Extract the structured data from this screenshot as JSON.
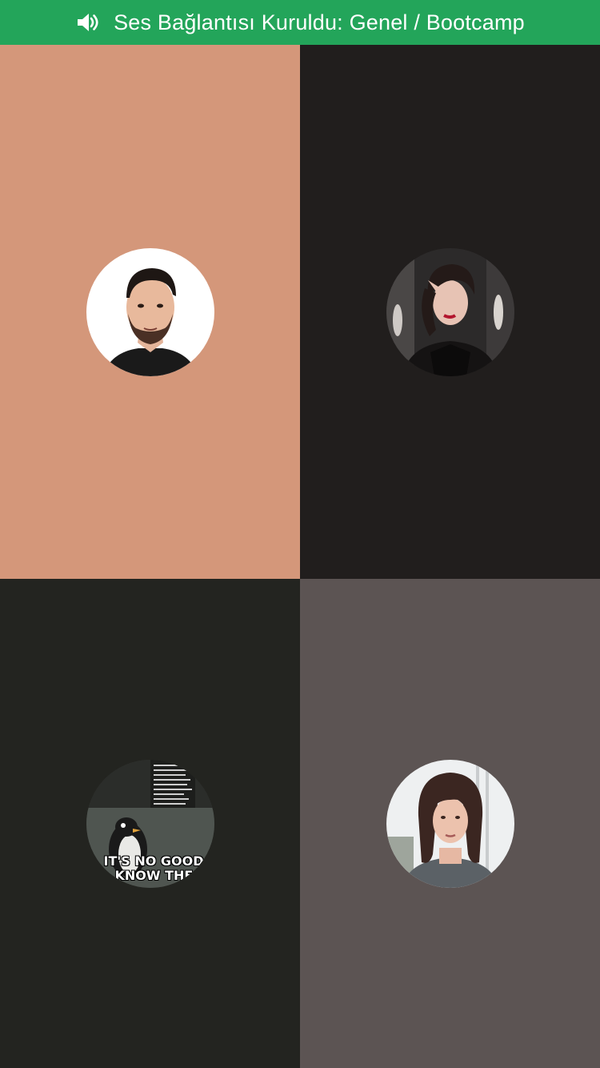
{
  "status_bar": {
    "text": "Ses Bağlantısı Kuruldu: Genel / Bootcamp",
    "icon": "speaker-icon",
    "color": "#23a55a"
  },
  "participants": [
    {
      "avatar": "avatar-man-beard",
      "tile_color": "#d4977a"
    },
    {
      "avatar": "avatar-woman-leather-jacket",
      "tile_color": "#211e1d"
    },
    {
      "avatar": "avatar-penguin-meme",
      "tile_color": "#232420",
      "avatar_caption_line1": "IT'S NO GOOD, I",
      "avatar_caption_line2": "KNOW THE"
    },
    {
      "avatar": "avatar-woman-turtleneck",
      "tile_color": "#5c5453"
    }
  ]
}
